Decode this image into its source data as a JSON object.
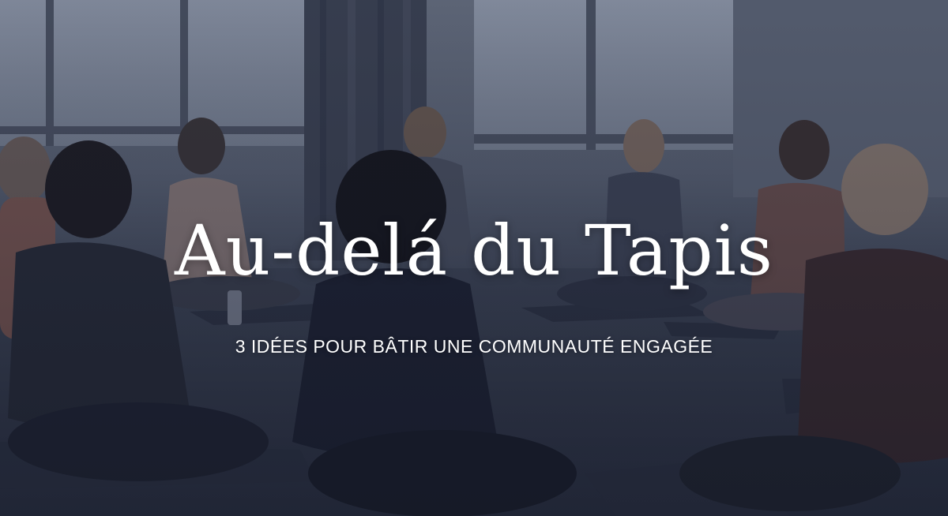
{
  "hero": {
    "title": "Au-delá du Tapis",
    "subtitle": "3 IDÉES POUR BÂTIR UNE COMMUNAUTÉ ENGAGÉE"
  },
  "colors": {
    "overlay": "#1e2a44",
    "text": "#ffffff"
  }
}
